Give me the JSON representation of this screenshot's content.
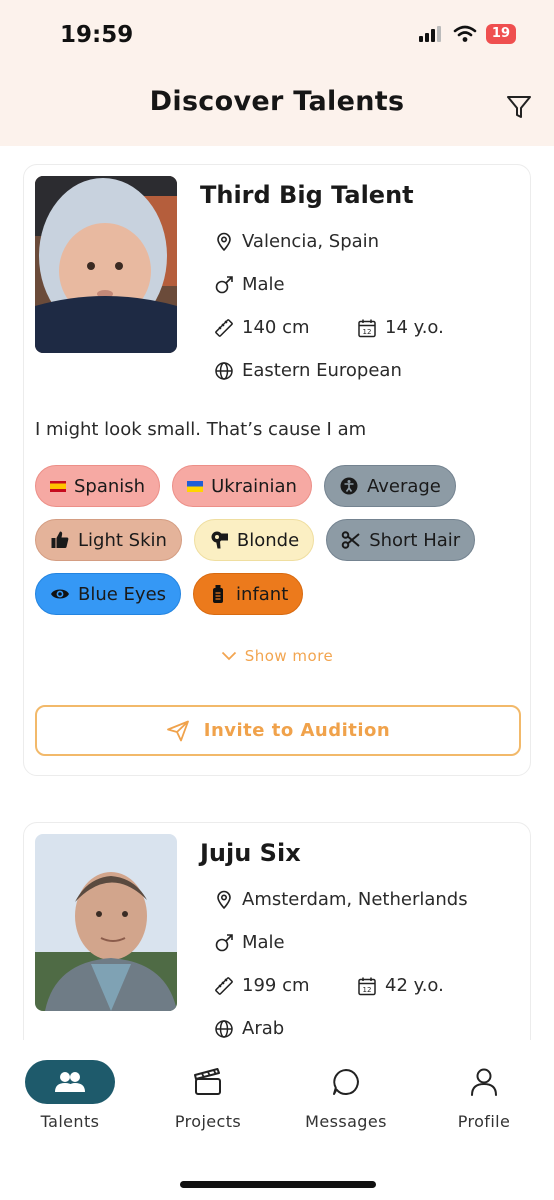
{
  "status": {
    "time": "19:59",
    "battery": "19"
  },
  "header": {
    "title": "Discover Talents"
  },
  "cards": [
    {
      "name": "Third Big Talent",
      "location": "Valencia, Spain",
      "gender": "Male",
      "height": "140 cm",
      "age": "14 y.o.",
      "ethnicity": "Eastern European",
      "bio": "I might look small. That’s cause I am",
      "tags": {
        "spanish": "Spanish",
        "ukrainian": "Ukrainian",
        "average": "Average",
        "light_skin": "Light Skin",
        "blonde": "Blonde",
        "short_hair": "Short Hair",
        "blue_eyes": "Blue Eyes",
        "infant": "infant"
      },
      "show_more": "Show more",
      "invite": "Invite to Audition"
    },
    {
      "name": "Juju Six",
      "location": "Amsterdam, Netherlands",
      "gender": "Male",
      "height": "199 cm",
      "age": "42 y.o.",
      "ethnicity": "Arab"
    }
  ],
  "nav": {
    "talents": "Talents",
    "projects": "Projects",
    "messages": "Messages",
    "profile": "Profile"
  },
  "colors": {
    "accent": "#f2a550",
    "nav_active": "#1e5a6b",
    "header_bg": "#fcf2ec"
  }
}
